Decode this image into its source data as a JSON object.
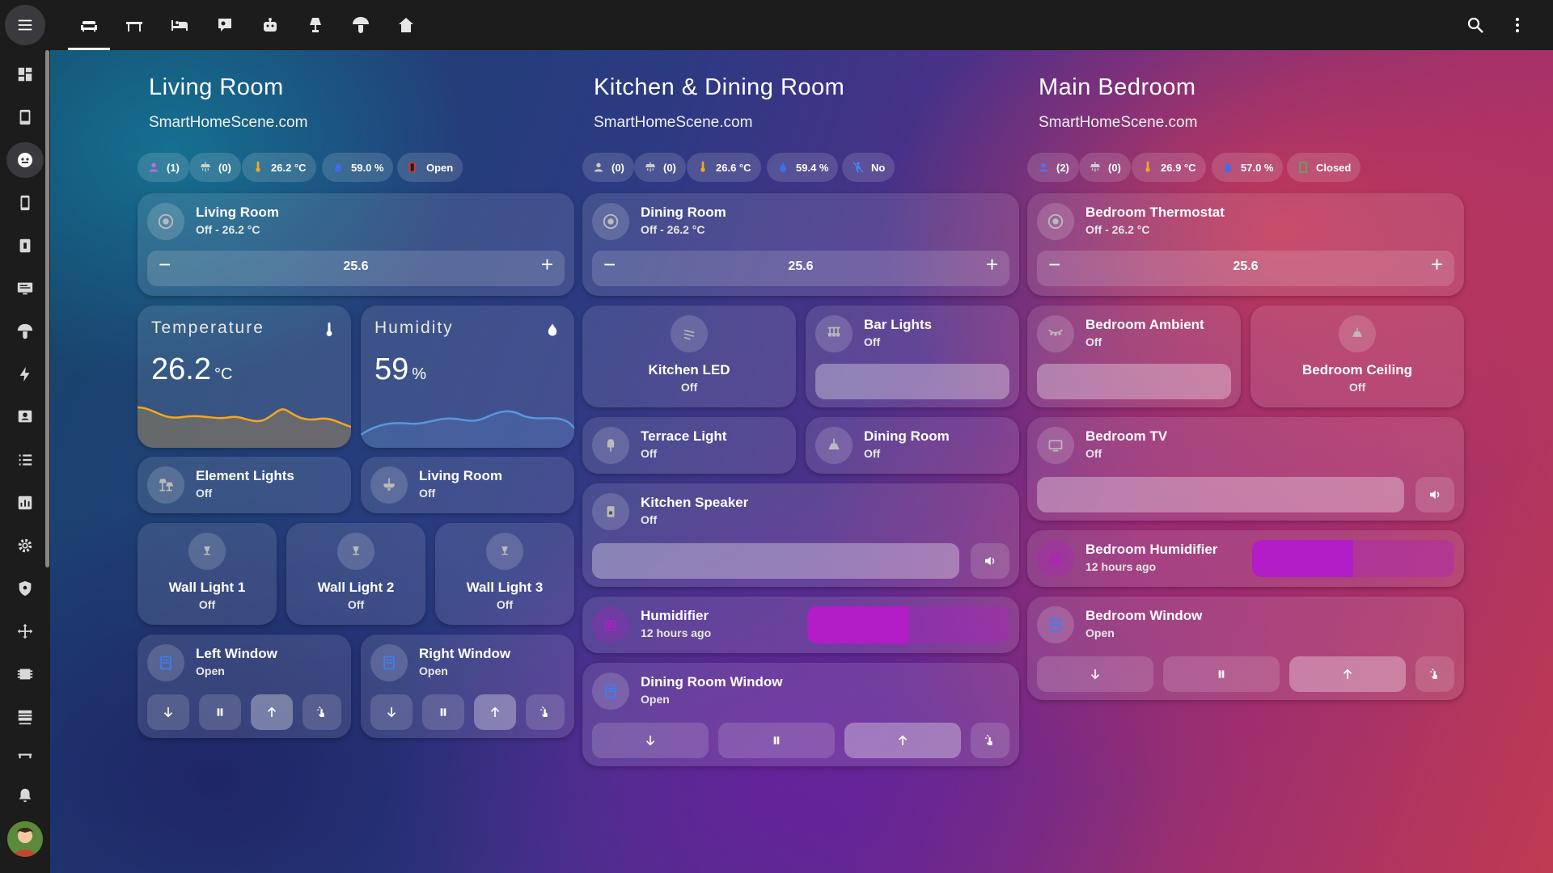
{
  "topbar": {
    "tabs": [
      "sofa-icon",
      "table-icon",
      "bed-icon",
      "tv-icon",
      "robot-icon",
      "lamp-icon",
      "mushroom-icon",
      "home-icon"
    ],
    "search": "search-icon",
    "more": "more-vert-icon"
  },
  "sidebar": {
    "items": [
      "dashboard",
      "tablet",
      "robot",
      "phone",
      "flash",
      "monitor",
      "mushroom",
      "energy",
      "badge",
      "list",
      "chart",
      "settings",
      "shield",
      "network",
      "memory",
      "hacs",
      "shelf"
    ],
    "notifications": "bell-icon"
  },
  "colors": {
    "accent_orange": "#f5a623",
    "humidifier": "#b21dc8",
    "window_blue": "#3b7ff2"
  },
  "rooms": [
    {
      "title": "Living Room",
      "subtitle": "SmartHomeScene.com",
      "chips": {
        "persons": "(1)",
        "lights": "(0)",
        "temp": "26.2 °C",
        "humidity": "59.0 %",
        "status": "Open"
      },
      "thermostat": {
        "name": "Living Room",
        "state": "Off - 26.2 °C",
        "value": "25.6"
      },
      "temperature": {
        "label": "Temperature",
        "value": "26.2",
        "unit": "°C"
      },
      "humidity": {
        "label": "Humidity",
        "value": "59",
        "unit": "%"
      },
      "lights": [
        {
          "name": "Element Lights",
          "state": "Off"
        },
        {
          "name": "Living Room",
          "state": "Off"
        }
      ],
      "walls": [
        {
          "name": "Wall Light 1",
          "state": "Off"
        },
        {
          "name": "Wall Light 2",
          "state": "Off"
        },
        {
          "name": "Wall Light 3",
          "state": "Off"
        }
      ],
      "windows": [
        {
          "name": "Left Window",
          "state": "Open"
        },
        {
          "name": "Right Window",
          "state": "Open"
        }
      ]
    },
    {
      "title": "Kitchen & Dining Room",
      "subtitle": "SmartHomeScene.com",
      "chips": {
        "persons": "(0)",
        "lights": "(0)",
        "temp": "26.6 °C",
        "humidity": "59.4 %",
        "status": "No"
      },
      "thermostat": {
        "name": "Dining Room",
        "state": "Off - 26.2 °C",
        "value": "25.6"
      },
      "led": {
        "name": "Kitchen LED",
        "state": "Off"
      },
      "bar": {
        "name": "Bar Lights",
        "state": "Off"
      },
      "terrace": {
        "name": "Terrace Light",
        "state": "Off"
      },
      "dining": {
        "name": "Dining Room",
        "state": "Off"
      },
      "speaker": {
        "name": "Kitchen Speaker",
        "state": "Off"
      },
      "humidifier": {
        "name": "Humidifier",
        "state": "12 hours ago",
        "level": 0.5
      },
      "window": {
        "name": "Dining Room Window",
        "state": "Open"
      }
    },
    {
      "title": "Main Bedroom",
      "subtitle": "SmartHomeScene.com",
      "chips": {
        "persons": "(2)",
        "lights": "(0)",
        "temp": "26.9 °C",
        "humidity": "57.0 %",
        "status": "Closed"
      },
      "thermostat": {
        "name": "Bedroom Thermostat",
        "state": "Off - 26.2 °C",
        "value": "25.6"
      },
      "ambient": {
        "name": "Bedroom Ambient",
        "state": "Off"
      },
      "ceiling": {
        "name": "Bedroom Ceiling",
        "state": "Off"
      },
      "tv": {
        "name": "Bedroom TV",
        "state": "Off"
      },
      "humidifier": {
        "name": "Bedroom Humidifier",
        "state": "12 hours ago",
        "level": 0.5
      },
      "window": {
        "name": "Bedroom Window",
        "state": "Open"
      }
    }
  ]
}
